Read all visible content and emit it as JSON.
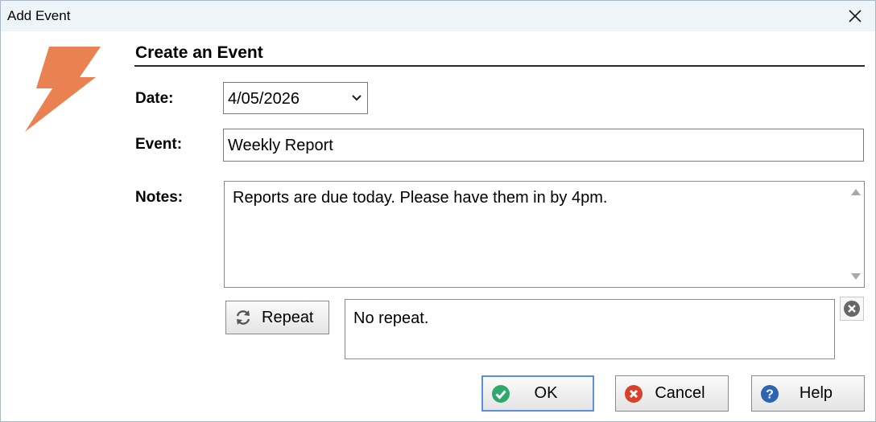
{
  "window": {
    "title": "Add Event"
  },
  "section": {
    "title": "Create an Event"
  },
  "form": {
    "date_label": "Date:",
    "date_value": "4/05/2026",
    "event_label": "Event:",
    "event_value": "Weekly Report",
    "notes_label": "Notes:",
    "notes_value": "Reports are due today.  Please have them in by 4pm."
  },
  "repeat": {
    "button_label": "Repeat",
    "summary": "No repeat."
  },
  "buttons": {
    "ok": "OK",
    "cancel": "Cancel",
    "help": "Help"
  },
  "icons": {
    "app": "lightning-bolt-icon",
    "close": "close-icon",
    "repeat": "refresh-icon",
    "clear": "clear-circle-icon",
    "ok": "check-circle-icon",
    "cancel": "x-circle-icon",
    "help": "question-circle-icon"
  },
  "colors": {
    "accent": "#ea8150",
    "ok": "#2ea86b",
    "cancel": "#d9412b",
    "help": "#2d64b3"
  }
}
